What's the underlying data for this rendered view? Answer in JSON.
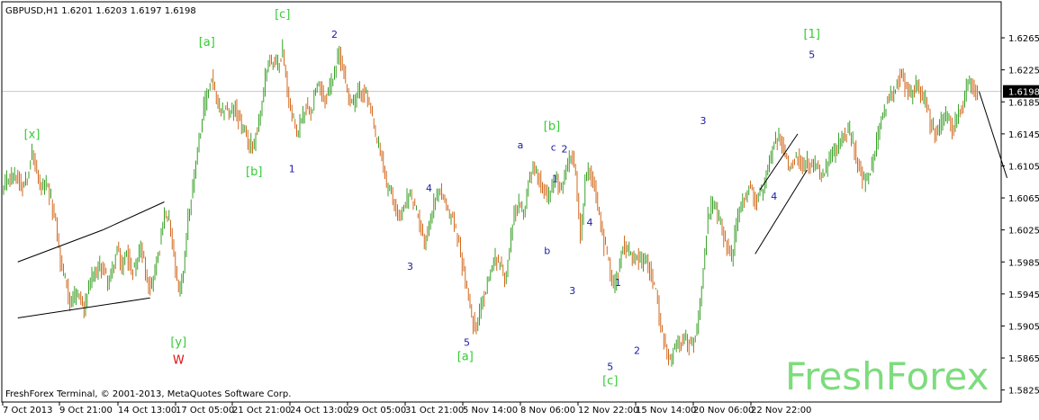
{
  "header": {
    "symbol_line": "GBPUSD,H1  1.6201 1.6203 1.6197 1.6198"
  },
  "footer": {
    "copyright": "FreshForex Terminal, © 2001-2013, MetaQuotes Software Corp."
  },
  "watermark": "FreshForex",
  "colors": {
    "background": "#ffffff",
    "candle_up": "#3aa12a",
    "candle_down": "#d2691e",
    "axis": "#000000",
    "price_line": "#c8c8c8",
    "wave_blue": "#1a1aa8",
    "wave_green": "#33cc33",
    "wave_red": "#e01010",
    "watermark": "#7ddc7d",
    "price_tag_bg": "#000000",
    "price_tag_text": "#ffffff"
  },
  "chart_data": {
    "type": "candlestick",
    "symbol": "GBPUSD",
    "timeframe": "H1",
    "ohlc_header": {
      "open": 1.6201,
      "high": 1.6203,
      "low": 1.6197,
      "close": 1.6198
    },
    "ylim": [
      1.581,
      1.631
    ],
    "y_ticks": [
      "1.6265",
      "1.6225",
      "1.6185",
      "1.6145",
      "1.6105",
      "1.6065",
      "1.6025",
      "1.5985",
      "1.5945",
      "1.5905",
      "1.5865",
      "1.5825"
    ],
    "x_ticks": [
      "7 Oct 2013",
      "9 Oct 21:00",
      "14 Oct 13:00",
      "17 Oct 05:00",
      "21 Oct 21:00",
      "24 Oct 13:00",
      "29 Oct 05:00",
      "31 Oct 21:00",
      "5 Nov 14:00",
      "8 Nov 06:00",
      "12 Nov 22:00",
      "15 Nov 14:00",
      "20 Nov 06:00",
      "22 Nov 22:00"
    ],
    "current_price": "1.6198",
    "price_path": [
      [
        0,
        1.6075
      ],
      [
        3,
        1.609
      ],
      [
        6,
        1.6095
      ],
      [
        9,
        1.609
      ],
      [
        12,
        1.608
      ],
      [
        15,
        1.6095
      ],
      [
        18,
        1.612
      ],
      [
        21,
        1.6095
      ],
      [
        24,
        1.6075
      ],
      [
        27,
        1.608
      ],
      [
        30,
        1.606
      ],
      [
        33,
        1.6035
      ],
      [
        36,
        1.5985
      ],
      [
        39,
        1.5965
      ],
      [
        42,
        1.5935
      ],
      [
        45,
        1.594
      ],
      [
        48,
        1.5945
      ],
      [
        51,
        1.5925
      ],
      [
        54,
        1.5955
      ],
      [
        57,
        1.5965
      ],
      [
        60,
        1.5975
      ],
      [
        63,
        1.598
      ],
      [
        66,
        1.596
      ],
      [
        69,
        1.5975
      ],
      [
        72,
        1.6
      ],
      [
        75,
        1.5975
      ],
      [
        78,
        1.6
      ],
      [
        81,
        1.597
      ],
      [
        84,
        1.5985
      ],
      [
        87,
        1.6005
      ],
      [
        90,
        1.5975
      ],
      [
        93,
        1.595
      ],
      [
        96,
        1.5975
      ],
      [
        99,
        1.6005
      ],
      [
        102,
        1.6045
      ],
      [
        105,
        1.6035
      ],
      [
        108,
        1.599
      ],
      [
        111,
        1.5945
      ],
      [
        114,
        1.5975
      ],
      [
        117,
        1.604
      ],
      [
        120,
        1.608
      ],
      [
        123,
        1.613
      ],
      [
        126,
        1.6165
      ],
      [
        129,
        1.6195
      ],
      [
        132,
        1.6215
      ],
      [
        135,
        1.6185
      ],
      [
        138,
        1.617
      ],
      [
        141,
        1.618
      ],
      [
        144,
        1.617
      ],
      [
        147,
        1.6175
      ],
      [
        150,
        1.616
      ],
      [
        153,
        1.6145
      ],
      [
        156,
        1.613
      ],
      [
        159,
        1.6135
      ],
      [
        162,
        1.616
      ],
      [
        165,
        1.62
      ],
      [
        168,
        1.624
      ],
      [
        171,
        1.6235
      ],
      [
        174,
        1.623
      ],
      [
        177,
        1.625
      ],
      [
        180,
        1.62
      ],
      [
        183,
        1.6165
      ],
      [
        186,
        1.6145
      ],
      [
        189,
        1.6165
      ],
      [
        192,
        1.618
      ],
      [
        195,
        1.6175
      ],
      [
        198,
        1.62
      ],
      [
        201,
        1.6205
      ],
      [
        204,
        1.6185
      ],
      [
        207,
        1.6205
      ],
      [
        210,
        1.6225
      ],
      [
        213,
        1.6245
      ],
      [
        216,
        1.622
      ],
      [
        219,
        1.619
      ],
      [
        222,
        1.6185
      ],
      [
        225,
        1.6195
      ],
      [
        228,
        1.62
      ],
      [
        231,
        1.619
      ],
      [
        234,
        1.616
      ],
      [
        237,
        1.6135
      ],
      [
        240,
        1.6115
      ],
      [
        243,
        1.608
      ],
      [
        246,
        1.607
      ],
      [
        249,
        1.605
      ],
      [
        252,
        1.604
      ],
      [
        255,
        1.606
      ],
      [
        258,
        1.607
      ],
      [
        261,
        1.605
      ],
      [
        264,
        1.6035
      ],
      [
        267,
        1.601
      ],
      [
        270,
        1.603
      ],
      [
        273,
        1.606
      ],
      [
        276,
        1.6075
      ],
      [
        279,
        1.6065
      ],
      [
        282,
        1.6045
      ],
      [
        285,
        1.604
      ],
      [
        288,
        1.6015
      ],
      [
        291,
        1.5985
      ],
      [
        294,
        1.595
      ],
      [
        297,
        1.5915
      ],
      [
        300,
        1.5905
      ],
      [
        303,
        1.593
      ],
      [
        306,
        1.595
      ],
      [
        309,
        1.5975
      ],
      [
        312,
        1.599
      ],
      [
        315,
        1.5985
      ],
      [
        318,
        1.596
      ],
      [
        321,
        1.6
      ],
      [
        324,
        1.6045
      ],
      [
        327,
        1.6055
      ],
      [
        330,
        1.6045
      ],
      [
        333,
        1.6085
      ],
      [
        336,
        1.6105
      ],
      [
        339,
        1.6095
      ],
      [
        342,
        1.608
      ],
      [
        345,
        1.6065
      ],
      [
        348,
        1.608
      ],
      [
        351,
        1.609
      ],
      [
        354,
        1.607
      ],
      [
        357,
        1.6105
      ],
      [
        360,
        1.612
      ],
      [
        363,
        1.6095
      ],
      [
        366,
        1.601
      ],
      [
        369,
        1.609
      ],
      [
        372,
        1.61
      ],
      [
        375,
        1.608
      ],
      [
        378,
        1.604
      ],
      [
        381,
        1.601
      ],
      [
        384,
        1.5985
      ],
      [
        387,
        1.5955
      ],
      [
        390,
        1.5975
      ],
      [
        393,
        1.601
      ],
      [
        396,
        1.6
      ],
      [
        399,
        1.5985
      ],
      [
        402,
        1.599
      ],
      [
        405,
        1.5985
      ],
      [
        408,
        1.599
      ],
      [
        411,
        1.597
      ],
      [
        414,
        1.5945
      ],
      [
        417,
        1.5905
      ],
      [
        420,
        1.5875
      ],
      [
        423,
        1.586
      ],
      [
        426,
        1.588
      ],
      [
        429,
        1.5885
      ],
      [
        432,
        1.589
      ],
      [
        435,
        1.588
      ],
      [
        438,
        1.5885
      ],
      [
        441,
        1.5915
      ],
      [
        444,
        1.5975
      ],
      [
        447,
        1.604
      ],
      [
        450,
        1.606
      ],
      [
        453,
        1.6045
      ],
      [
        456,
        1.6025
      ],
      [
        459,
        1.6005
      ],
      [
        462,
        1.599
      ],
      [
        465,
        1.603
      ],
      [
        468,
        1.6055
      ],
      [
        471,
        1.607
      ],
      [
        474,
        1.608
      ],
      [
        477,
        1.606
      ],
      [
        480,
        1.607
      ],
      [
        483,
        1.608
      ],
      [
        486,
        1.611
      ],
      [
        489,
        1.613
      ],
      [
        492,
        1.614
      ],
      [
        495,
        1.6125
      ],
      [
        498,
        1.6105
      ],
      [
        501,
        1.611
      ],
      [
        504,
        1.612
      ],
      [
        507,
        1.6105
      ],
      [
        510,
        1.611
      ],
      [
        513,
        1.61
      ],
      [
        516,
        1.6105
      ],
      [
        519,
        1.609
      ],
      [
        522,
        1.61
      ],
      [
        525,
        1.6115
      ],
      [
        528,
        1.6125
      ],
      [
        531,
        1.6135
      ],
      [
        534,
        1.6145
      ],
      [
        537,
        1.615
      ],
      [
        540,
        1.6125
      ],
      [
        543,
        1.61
      ],
      [
        546,
        1.6085
      ],
      [
        549,
        1.609
      ],
      [
        552,
        1.611
      ],
      [
        555,
        1.6145
      ],
      [
        558,
        1.617
      ],
      [
        561,
        1.619
      ],
      [
        564,
        1.6195
      ],
      [
        567,
        1.621
      ],
      [
        570,
        1.622
      ],
      [
        573,
        1.62
      ],
      [
        576,
        1.619
      ],
      [
        579,
        1.621
      ],
      [
        582,
        1.62
      ],
      [
        585,
        1.6185
      ],
      [
        588,
        1.616
      ],
      [
        591,
        1.6145
      ],
      [
        594,
        1.615
      ],
      [
        597,
        1.617
      ],
      [
        600,
        1.616
      ],
      [
        603,
        1.615
      ],
      [
        606,
        1.617
      ],
      [
        609,
        1.6185
      ],
      [
        612,
        1.621
      ],
      [
        615,
        1.6205
      ],
      [
        618,
        1.6198
      ]
    ],
    "forecast_line": [
      [
        618,
        1.6198
      ],
      [
        630,
        1.609
      ]
    ],
    "trendlines": [
      [
        [
          9,
          1.5985
        ],
        [
          63,
          1.6025
        ]
      ],
      [
        [
          9,
          1.5915
        ],
        [
          93,
          1.594
        ]
      ],
      [
        [
          63,
          1.6025
        ],
        [
          102,
          1.606
        ]
      ],
      [
        [
          477,
          1.5995
        ],
        [
          510,
          1.61
        ]
      ],
      [
        [
          480,
          1.6075
        ],
        [
          504,
          1.6145
        ]
      ]
    ],
    "wave_labels": [
      {
        "text": "[x]",
        "x": 18,
        "y": 1.614,
        "color": "green"
      },
      {
        "text": "[a]",
        "x": 129,
        "y": 1.6255,
        "color": "green"
      },
      {
        "text": "[c]",
        "x": 177,
        "y": 1.629,
        "color": "green"
      },
      {
        "text": "[b]",
        "x": 159,
        "y": 1.6093,
        "color": "green"
      },
      {
        "text": "1",
        "x": 183,
        "y": 1.6097,
        "color": "blue"
      },
      {
        "text": "2",
        "x": 210,
        "y": 1.6265,
        "color": "blue"
      },
      {
        "text": "3",
        "x": 258,
        "y": 1.5975,
        "color": "blue"
      },
      {
        "text": "4",
        "x": 270,
        "y": 1.6073,
        "color": "blue"
      },
      {
        "text": "5",
        "x": 294,
        "y": 1.588,
        "color": "blue"
      },
      {
        "text": "[a]",
        "x": 293,
        "y": 1.5862,
        "color": "green"
      },
      {
        "text": "a",
        "x": 328,
        "y": 1.6127,
        "color": "blue"
      },
      {
        "text": "c",
        "x": 349,
        "y": 1.6124,
        "color": "blue"
      },
      {
        "text": "2",
        "x": 356,
        "y": 1.6122,
        "color": "blue"
      },
      {
        "text": "[b]",
        "x": 348,
        "y": 1.615,
        "color": "green"
      },
      {
        "text": "1",
        "x": 350,
        "y": 1.6085,
        "color": "blue"
      },
      {
        "text": "b",
        "x": 345,
        "y": 1.5995,
        "color": "blue"
      },
      {
        "text": "4",
        "x": 372,
        "y": 1.603,
        "color": "blue"
      },
      {
        "text": "3",
        "x": 361,
        "y": 1.5945,
        "color": "blue"
      },
      {
        "text": "1",
        "x": 390,
        "y": 1.5955,
        "color": "blue"
      },
      {
        "text": "2",
        "x": 402,
        "y": 1.587,
        "color": "blue"
      },
      {
        "text": "5",
        "x": 385,
        "y": 1.585,
        "color": "blue"
      },
      {
        "text": "[c]",
        "x": 385,
        "y": 1.5832,
        "color": "green"
      },
      {
        "text": "3",
        "x": 444,
        "y": 1.6157,
        "color": "blue"
      },
      {
        "text": "4",
        "x": 489,
        "y": 1.6063,
        "color": "blue"
      },
      {
        "text": "5",
        "x": 513,
        "y": 1.624,
        "color": "blue"
      },
      {
        "text": "[1]",
        "x": 513,
        "y": 1.6265,
        "color": "green"
      },
      {
        "text": "[y]",
        "x": 111,
        "y": 1.588,
        "color": "green"
      },
      {
        "text": "W",
        "x": 111,
        "y": 1.5858,
        "color": "red"
      }
    ]
  }
}
